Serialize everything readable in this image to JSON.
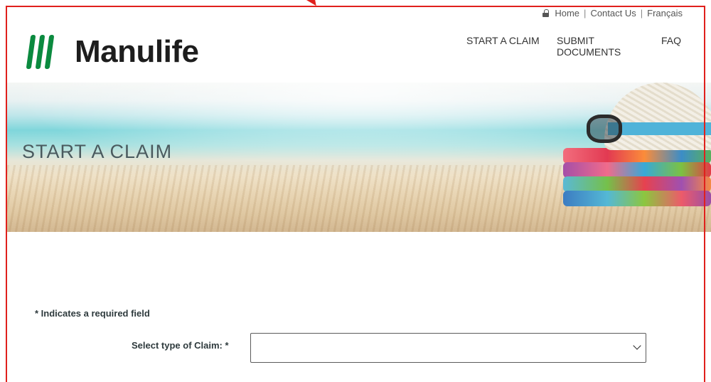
{
  "utility": {
    "home": "Home",
    "separator": "|",
    "contact": "Contact Us",
    "language": "Français"
  },
  "logo": {
    "text": "Manulife",
    "brand_color": "#0b8a3f"
  },
  "nav": {
    "items": [
      {
        "label": "START A CLAIM"
      },
      {
        "label": "SUBMIT DOCUMENTS"
      },
      {
        "label": "FAQ"
      }
    ]
  },
  "hero": {
    "title": "START A CLAIM"
  },
  "form": {
    "required_note": "* Indicates a required field",
    "claim_type_label": "Select type of Claim: *",
    "claim_type_value": ""
  },
  "colors": {
    "annotation_frame": "#e0201c",
    "text": "#2e3a3d"
  }
}
